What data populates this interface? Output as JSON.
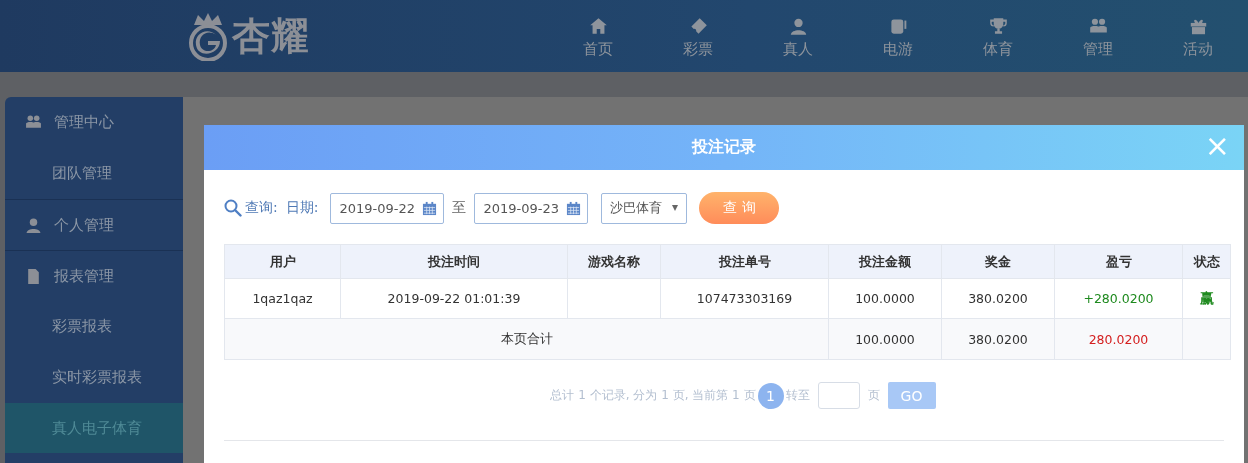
{
  "header": {
    "logo_text": "杏耀",
    "nav": [
      {
        "label": "首页"
      },
      {
        "label": "彩票"
      },
      {
        "label": "真人"
      },
      {
        "label": "电游"
      },
      {
        "label": "体育"
      },
      {
        "label": "管理"
      },
      {
        "label": "活动"
      }
    ]
  },
  "sidebar": {
    "items": [
      {
        "label": "管理中心",
        "kind": "section",
        "selected": false
      },
      {
        "label": "团队管理",
        "kind": "item",
        "selected": false
      },
      {
        "label": "个人管理",
        "kind": "section",
        "selected": false
      },
      {
        "label": "报表管理",
        "kind": "section",
        "selected": false
      },
      {
        "label": "彩票报表",
        "kind": "item",
        "selected": false
      },
      {
        "label": "实时彩票报表",
        "kind": "item",
        "selected": false
      },
      {
        "label": "真人电子体育",
        "kind": "item",
        "selected": true
      }
    ]
  },
  "dialog": {
    "title": "投注记录",
    "close": "×",
    "filter": {
      "query_label": "查询:",
      "date_label": "日期:",
      "date_from": "2019-09-22",
      "separator": "至",
      "date_to": "2019-09-23",
      "platform": "沙巴体育",
      "search_button": "查 询"
    },
    "table": {
      "columns": [
        "用户",
        "投注时间",
        "游戏名称",
        "投注单号",
        "投注金额",
        "奖金",
        "盈亏",
        "状态"
      ],
      "rows": [
        {
          "user": "1qaz1qaz",
          "bet_time": "2019-09-22 01:01:39",
          "bet_number": "107473303169",
          "amount": "100.0000",
          "bonus": "380.0200",
          "profit": {
            "text": "+280.0200",
            "color": "#1e8a1e"
          },
          "status": {
            "text": "赢",
            "color": "#1e8a1e"
          }
        }
      ],
      "totals": {
        "label": "本页合计",
        "amount": "100.0000",
        "bonus": "380.0200",
        "profit": {
          "text": "280.0200",
          "color": "#d42020"
        }
      }
    },
    "pagination": {
      "summary": "总计 1 个记录, 分为 1 页, 当前第 1 页",
      "pages": [
        {
          "label": "1",
          "selected": true
        }
      ],
      "goto_label": "转至",
      "page_unit": "页",
      "go_button": "GO"
    }
  }
}
